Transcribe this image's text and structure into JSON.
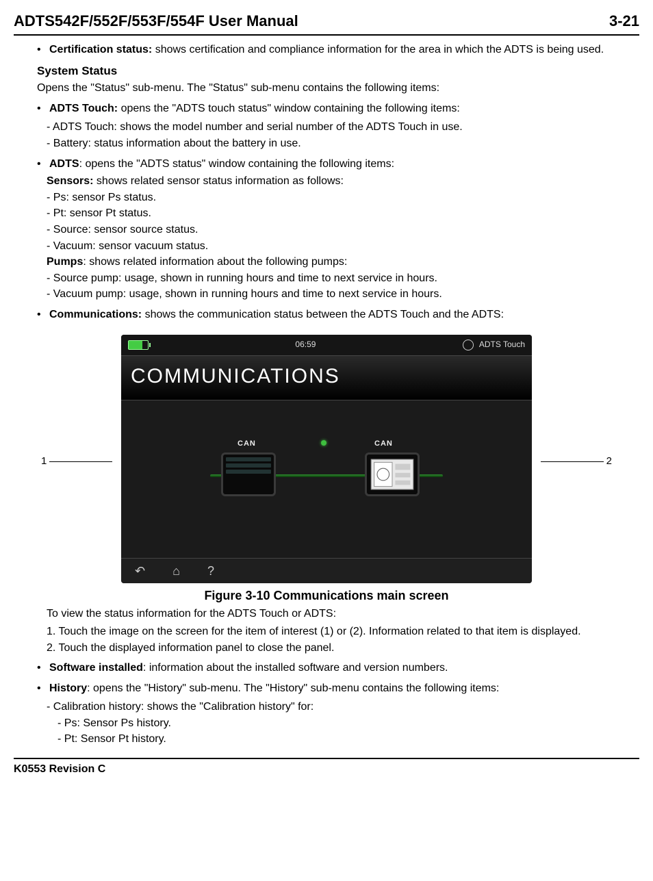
{
  "header": {
    "title": "ADTS542F/552F/553F/554F User Manual",
    "page": "3-21"
  },
  "bullets": {
    "cert_status_label": "Certification status:",
    "cert_status_text": " shows certification and compliance information for the area in which the ADTS is being used.",
    "system_status_heading": "System Status",
    "system_status_intro": "Opens the \"Status\" sub-menu. The \"Status\" sub-menu contains the following items:",
    "adts_touch_label": "ADTS Touch:",
    "adts_touch_text": " opens the \"ADTS touch status\" window containing the following items:",
    "adts_touch_sub1": "- ADTS Touch: shows the model number and serial number of the ADTS Touch in use.",
    "adts_touch_sub2": "- Battery: status information about the battery in use.",
    "adts_label": "ADTS",
    "adts_text": ": opens the \"ADTS status\" window containing the following items:",
    "sensors_label": "Sensors:",
    "sensors_text": " shows related sensor status information as follows:",
    "ps": "- Ps: sensor Ps status.",
    "pt": "- Pt: sensor Pt status.",
    "source": "- Source: sensor source status.",
    "vacuum": "- Vacuum: sensor vacuum status.",
    "pumps_label": "Pumps",
    "pumps_text": ": shows related information about the following pumps:",
    "src_pump": "- Source pump: usage, shown in running hours and time to next service in hours.",
    "vac_pump": "- Vacuum pump: usage, shown in running hours and time to next service in hours.",
    "comms_label": "Communications:",
    "comms_text": " shows the communication status between the ADTS Touch and the ADTS:"
  },
  "figure": {
    "callout1": "1",
    "callout2": "2",
    "statusbar_time": "06:59",
    "statusbar_brand": "ADTS Touch",
    "title": "COMMUNICATIONS",
    "can_left": "CAN",
    "can_right": "CAN",
    "caption": "Figure 3-10 Communications main screen"
  },
  "post_figure": {
    "intro": "To view the status information for the ADTS Touch or ADTS:",
    "step1": "1. Touch the image on the screen for the item of interest (1) or (2). Information related to that item is displayed.",
    "step2": "2. Touch the displayed information panel to close the panel.",
    "software_label": "Software installed",
    "software_text": ": information about the installed software and version numbers.",
    "history_label": "History",
    "history_text": ": opens the \"History\" sub-menu. The \"History\" sub-menu contains the following items:",
    "cal_hist": "- Calibration history: shows the \"Calibration history\" for:",
    "cal_ps": "- Ps: Sensor Ps history.",
    "cal_pt": "- Pt: Sensor Pt history."
  },
  "footer": {
    "revision": "K0553 Revision C"
  }
}
